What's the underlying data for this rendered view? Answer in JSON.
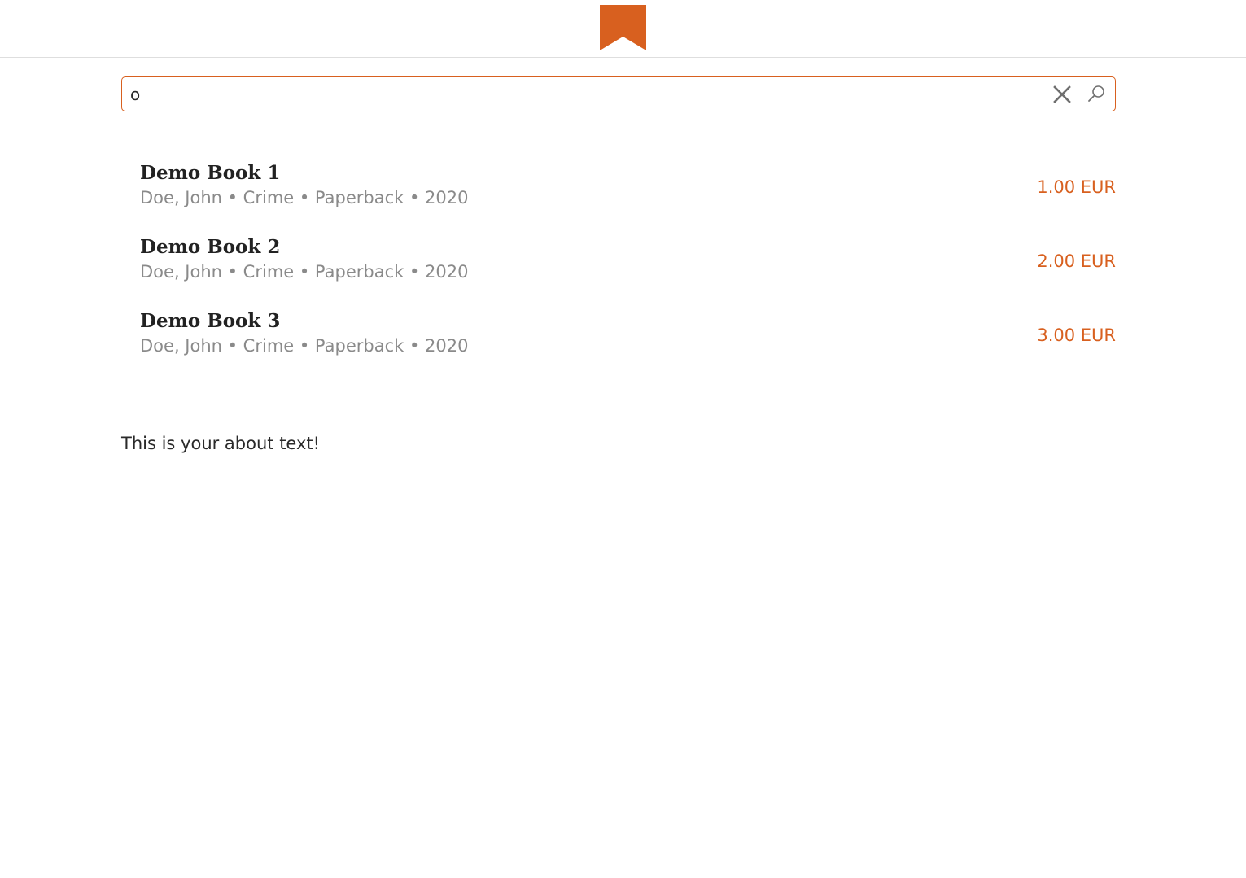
{
  "brand": {
    "logo_icon": "bookmark-icon",
    "accent_color": "#d8601f"
  },
  "search": {
    "value": "o",
    "clear_icon": "close-icon",
    "submit_icon": "search-icon"
  },
  "results": [
    {
      "title": "Demo Book 1",
      "meta": "Doe, John • Crime • Paperback • 2020",
      "price": "1.00 EUR"
    },
    {
      "title": "Demo Book 2",
      "meta": "Doe, John • Crime • Paperback • 2020",
      "price": "2.00 EUR"
    },
    {
      "title": "Demo Book 3",
      "meta": "Doe, John • Crime • Paperback • 2020",
      "price": "3.00 EUR"
    }
  ],
  "about": {
    "text": "This is your about text!"
  }
}
